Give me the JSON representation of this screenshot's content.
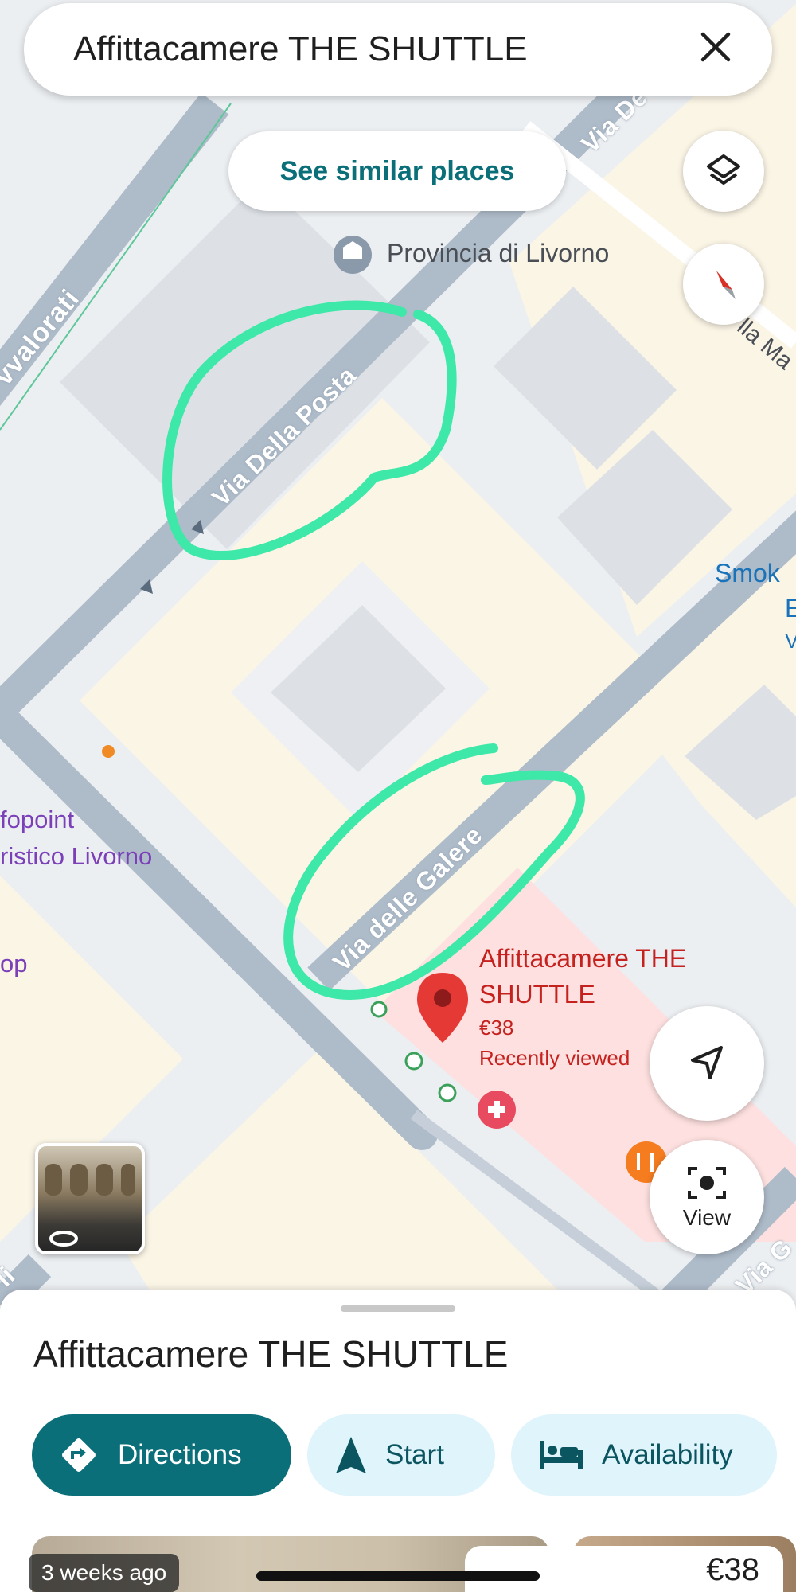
{
  "search_bar": {
    "title": "Affittacamere THE SHUTTLE"
  },
  "similar_places_label": "See similar places",
  "map": {
    "streets": {
      "via_della_posta": "Via Della Posta",
      "via_delle_galere": "Via delle Galere",
      "avvalorati": "vvalorati",
      "via_top": "Via De",
      "via_right_top": "lla Ma",
      "via_bottom_right": "Via G",
      "left_edge_bottom": "li"
    },
    "pois": {
      "provincia": "Provincia di Livorno",
      "smoke_line1": "Smok",
      "smoke_line2": "E",
      "smoke_line3": "V",
      "infopoint_line1": "fopoint",
      "infopoint_line2": "ristico Livorno",
      "shop": "op"
    },
    "selected_place": {
      "name_line1": "Affittacamere THE",
      "name_line2": "SHUTTLE",
      "price": "€38",
      "status": "Recently viewed"
    },
    "view_label": "View",
    "accent_color": "#0b6f79",
    "annotation_color": "#3ee8a8"
  },
  "sheet": {
    "title": "Affittacamere THE SHUTTLE",
    "actions": {
      "directions": "Directions",
      "start": "Start",
      "availability": "Availability"
    },
    "photo_badge": "3 weeks ago",
    "price": "€38"
  }
}
